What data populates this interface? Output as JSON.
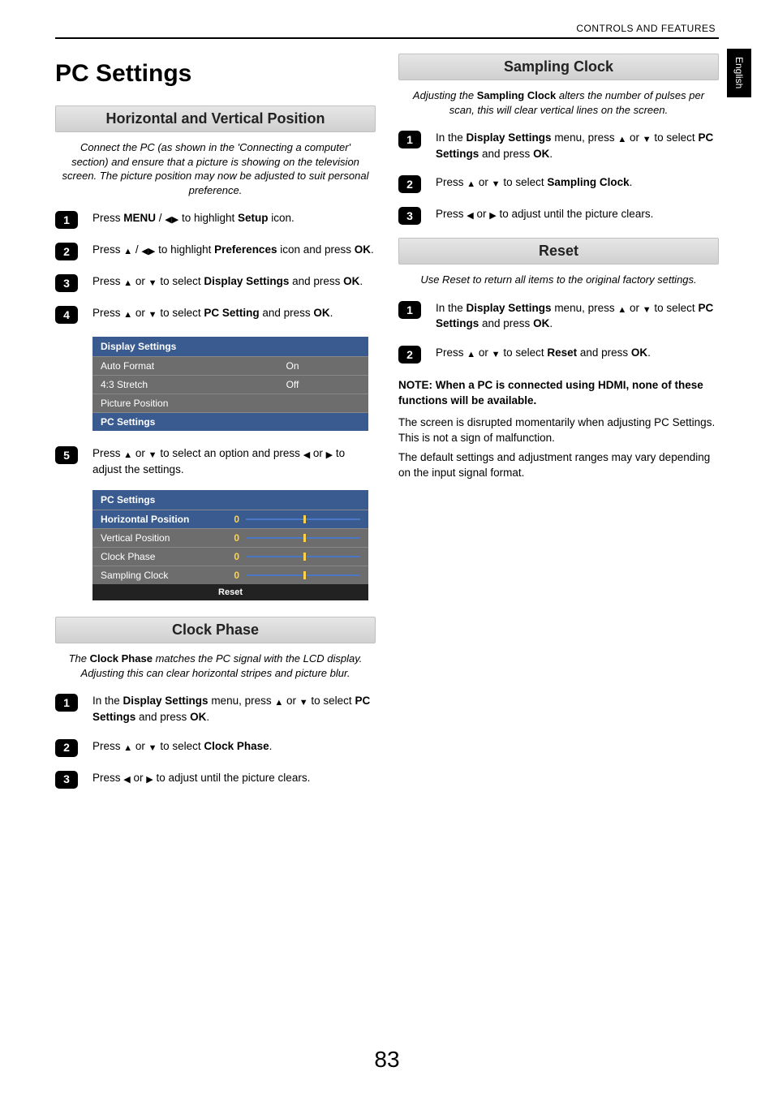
{
  "header_label": "CONTROLS AND FEATURES",
  "side_tab": "English",
  "page_title": "PC Settings",
  "page_number": "83",
  "icons": {
    "up": "▲",
    "down": "▼",
    "left": "◀",
    "right": "▶",
    "leftright": "◀▶"
  },
  "hv": {
    "title": "Horizontal and Vertical Position",
    "intro": "Connect the PC (as shown in the 'Connecting a computer' section) and ensure that a picture is showing on the television screen. The picture position may now be adjusted to suit personal preference.",
    "steps": {
      "s1a": "Press ",
      "s1b": "MENU",
      "s1c": " / ",
      "s1d": " to highlight ",
      "s1e": "Setup",
      "s1f": " icon.",
      "s2a": "Press ",
      "s2b": " / ",
      "s2c": " to highlight ",
      "s2d": "Preferences",
      "s2e": " icon and press ",
      "s2f": "OK",
      "s2g": ".",
      "s3a": "Press ",
      "s3b": " or ",
      "s3c": " to select ",
      "s3d": "Display Settings",
      "s3e": " and press ",
      "s3f": "OK",
      "s3g": ".",
      "s4a": "Press ",
      "s4b": " or ",
      "s4c": " to select ",
      "s4d": "PC Setting",
      "s4e": " and press ",
      "s4f": "OK",
      "s4g": ".",
      "s5a": "Press ",
      "s5b": " or ",
      "s5c": " to select an option and press ",
      "s5d": " or ",
      "s5e": " to adjust the settings."
    }
  },
  "display_menu": {
    "header": "Display Settings",
    "rows": [
      {
        "label": "Auto Format",
        "value": "On"
      },
      {
        "label": "4:3 Stretch",
        "value": "Off"
      },
      {
        "label": "Picture Position",
        "value": ""
      },
      {
        "label": "PC Settings",
        "value": "",
        "selected": true
      }
    ]
  },
  "pc_menu": {
    "header": "PC Settings",
    "rows": [
      {
        "label": "Horizontal Position",
        "value": "0",
        "selected": true
      },
      {
        "label": "Vertical Position",
        "value": "0"
      },
      {
        "label": "Clock Phase",
        "value": "0"
      },
      {
        "label": "Sampling Clock",
        "value": "0"
      }
    ],
    "footer": "Reset"
  },
  "clock_phase": {
    "title": "Clock Phase",
    "intro_a": "The ",
    "intro_b": "Clock Phase",
    "intro_c": " matches the PC signal with the LCD display. Adjusting this can clear horizontal stripes and picture blur.",
    "s1a": "In the ",
    "s1b": "Display Settings",
    "s1c": " menu, press ",
    "s1d": " or ",
    "s1e": " to select ",
    "s1f": "PC Settings",
    "s1g": " and press ",
    "s1h": "OK",
    "s1i": ".",
    "s2a": "Press ",
    "s2b": " or ",
    "s2c": " to select ",
    "s2d": "Clock Phase",
    "s2e": ".",
    "s3a": "Press ",
    "s3b": " or ",
    "s3c": " to adjust until the picture clears."
  },
  "sampling_clock": {
    "title": "Sampling Clock",
    "intro_a": "Adjusting the ",
    "intro_b": "Sampling Clock",
    "intro_c": " alters the number of pulses per scan, this will clear vertical lines on the screen.",
    "s1a": "In the ",
    "s1b": "Display Settings",
    "s1c": " menu, press ",
    "s1d": " or ",
    "s1e": " to select ",
    "s1f": "PC Settings",
    "s1g": " and press ",
    "s1h": "OK",
    "s1i": ".",
    "s2a": "Press ",
    "s2b": " or ",
    "s2c": " to select ",
    "s2d": "Sampling Clock",
    "s2e": ".",
    "s3a": "Press ",
    "s3b": " or ",
    "s3c": " to adjust until the picture clears."
  },
  "reset": {
    "title": "Reset",
    "intro": "Use Reset to return all items to the original factory settings.",
    "s1a": "In the ",
    "s1b": "Display Settings",
    "s1c": " menu, press ",
    "s1d": " or ",
    "s1e": " to select ",
    "s1f": "PC Settings",
    "s1g": " and press ",
    "s1h": "OK",
    "s1i": ".",
    "s2a": "Press ",
    "s2b": " or ",
    "s2c": " to select ",
    "s2d": "Reset",
    "s2e": " and press ",
    "s2f": "OK",
    "s2g": "."
  },
  "note_text": "NOTE: When a PC is connected using HDMI, none of these functions will be available.",
  "body1": "The screen is disrupted momentarily when adjusting PC Settings. This is not a sign of malfunction.",
  "body2": "The default settings and adjustment ranges may vary depending on the input signal format."
}
